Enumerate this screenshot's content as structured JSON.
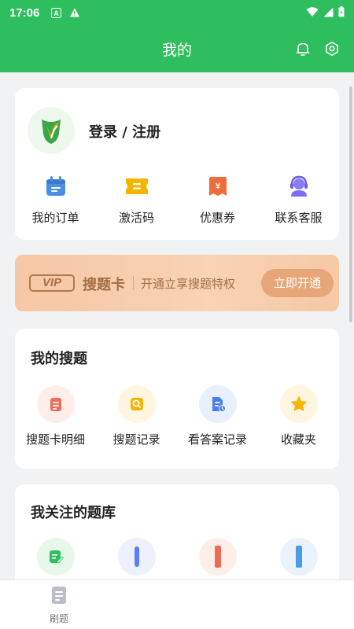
{
  "status_bar": {
    "time": "17:06"
  },
  "header": {
    "title": "我的",
    "bell_icon": "bell-icon",
    "settings_icon": "gear-icon"
  },
  "profile": {
    "login_text": "登录 / 注册",
    "shortcuts": [
      {
        "label": "我的订单",
        "icon": "calendar-icon",
        "color": "#4a90e2"
      },
      {
        "label": "激活码",
        "icon": "ticket-icon",
        "color": "#f5b400"
      },
      {
        "label": "优惠券",
        "icon": "coupon-icon",
        "color": "#f26b3a"
      },
      {
        "label": "联系客服",
        "icon": "headset-icon",
        "color": "#7b6cf6"
      }
    ]
  },
  "vip": {
    "badge": "VIP",
    "title": "搜题卡",
    "description": "开通立享搜题特权",
    "button": "立即开通"
  },
  "my_search": {
    "title": "我的搜题",
    "items": [
      {
        "label": "搜题卡明细",
        "icon": "card-detail-icon",
        "bg": "#fdeeea",
        "color": "#f26b5a"
      },
      {
        "label": "搜题记录",
        "icon": "search-record-icon",
        "bg": "#fff5e0",
        "color": "#f5b400"
      },
      {
        "label": "看答案记录",
        "icon": "document-clock-icon",
        "bg": "#e8f0fe",
        "color": "#4a80e8"
      },
      {
        "label": "收藏夹",
        "icon": "star-icon",
        "bg": "#fff5e0",
        "color": "#f5b400"
      }
    ]
  },
  "followed_banks": {
    "title": "我关注的题库",
    "items": [
      {
        "icon": "edit-note-icon",
        "bg": "#e7f7ea",
        "color": "#2fbe5e"
      },
      {
        "icon": "blue-book-icon",
        "bg": "#eef1fb",
        "color": "#5b7ff0"
      },
      {
        "icon": "red-book-icon",
        "bg": "#fdeeea",
        "color": "#f06a5a"
      },
      {
        "icon": "teal-book-icon",
        "bg": "#eaf3fb",
        "color": "#4a9be8"
      }
    ]
  },
  "bottom_nav": {
    "tab_label": "刷题",
    "tab_icon": "document-icon"
  }
}
